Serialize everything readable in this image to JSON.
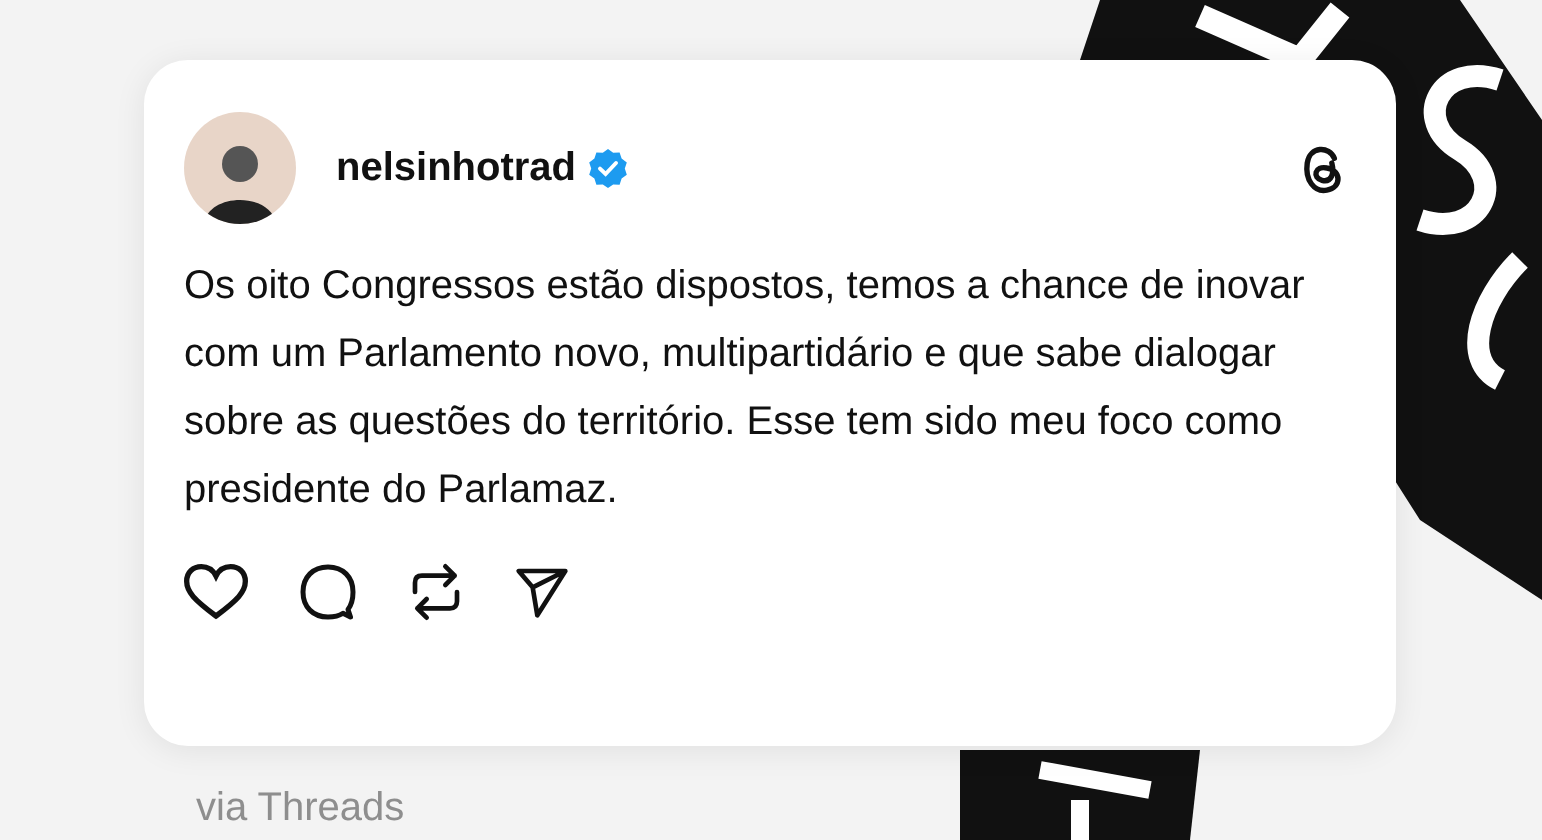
{
  "post": {
    "username": "nelsinhotrad",
    "verified": true,
    "text": "Os oito Congressos estão dispostos, temos a chance de inovar com um Parlamento novo, multipartidário e que sabe dialogar sobre as questões do território. Esse tem sido meu foco como presidente do Parlamaz."
  },
  "caption": "via Threads"
}
